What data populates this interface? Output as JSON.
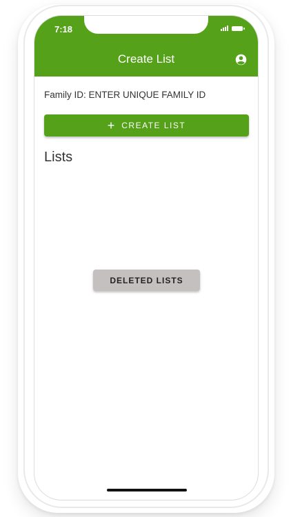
{
  "status_bar": {
    "time": "7:18",
    "icons": [
      "signal-icon",
      "battery-icon"
    ]
  },
  "header": {
    "title": "Create List",
    "account_icon": "account-circle-icon",
    "background_color": "#55a11a"
  },
  "family_id": {
    "text": "Family ID: ENTER UNIQUE FAMILY ID"
  },
  "create_button": {
    "icon": "+",
    "label": "CREATE LIST"
  },
  "lists": {
    "heading": "Lists",
    "items": []
  },
  "deleted_button": {
    "label": "DELETED LISTS",
    "background_color": "#c4c0c0"
  }
}
